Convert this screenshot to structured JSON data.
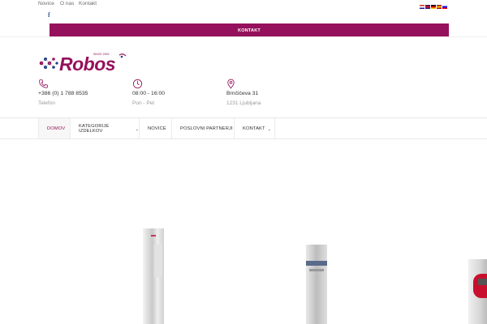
{
  "top_nav": {
    "items": [
      {
        "label": "Novice"
      },
      {
        "label": "O nas"
      },
      {
        "label": "Kontakt"
      }
    ]
  },
  "languages": [
    {
      "name": "hr-flag-icon"
    },
    {
      "name": "en-flag-icon"
    },
    {
      "name": "de-flag-icon"
    },
    {
      "name": "es-flag-icon"
    },
    {
      "name": "sl-flag-icon"
    }
  ],
  "social": {
    "facebook_icon": "f"
  },
  "contact_bar": {
    "label": "KONTAKT"
  },
  "logo": {
    "text": "Robos",
    "tagline": "SINCE 2009",
    "color_primary": "#96115b",
    "color_secondary": "#1f3b8c"
  },
  "info": {
    "phone": {
      "line1": "+386 (0) 1 788 8535",
      "line2": "Telefon"
    },
    "hours": {
      "line1": "08:00 - 16:00",
      "line2": "Pon - Pet"
    },
    "address": {
      "line1": "Brnčičeva 31",
      "line2": "1231 Ljubljana"
    }
  },
  "main_nav": {
    "items": [
      {
        "label": "DOMOV",
        "active": true
      },
      {
        "label": "KATEGORIJE IZDELKOV",
        "has_dropdown": true
      },
      {
        "label": "NOVICE"
      },
      {
        "label": "POSLOVNI PARTNERJI"
      },
      {
        "label": "KONTAKT",
        "has_dropdown": true
      }
    ]
  },
  "accent_color": "#96115b",
  "chevron": "⌄"
}
